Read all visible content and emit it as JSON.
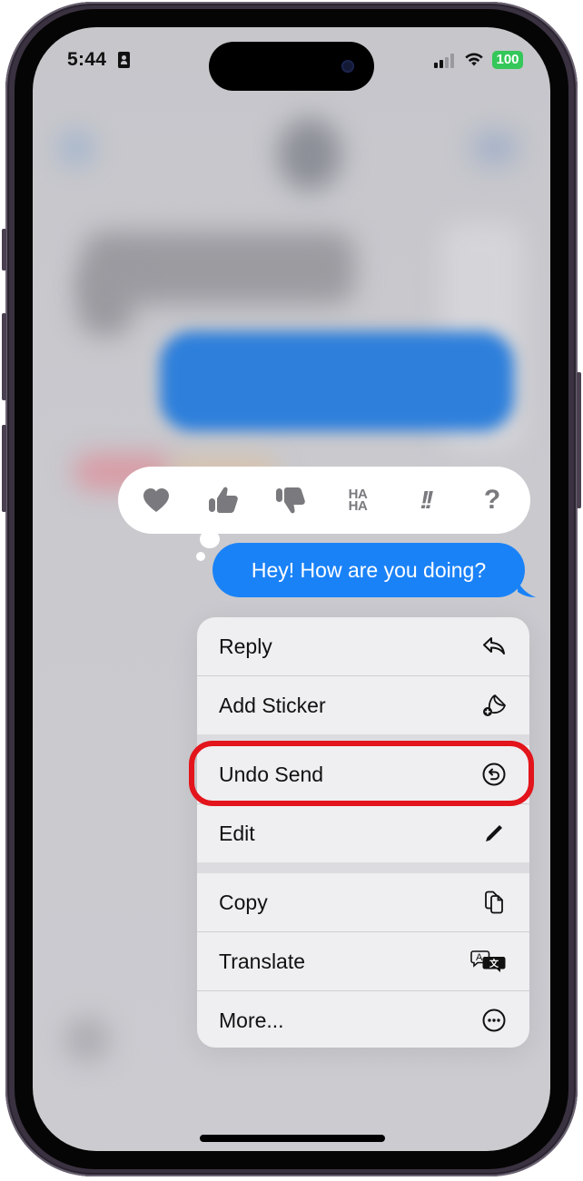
{
  "status_bar": {
    "time": "5:44",
    "battery": "100",
    "icons": [
      "contact-card-icon",
      "cellular-signal-icon",
      "wifi-icon",
      "battery-icon"
    ]
  },
  "reactions": [
    {
      "name": "heart",
      "icon": "heart-icon"
    },
    {
      "name": "thumbs-up",
      "icon": "thumbs-up-icon"
    },
    {
      "name": "thumbs-down",
      "icon": "thumbs-down-icon"
    },
    {
      "name": "haha",
      "label_top": "HA",
      "label_bottom": "HA",
      "icon": "haha-icon"
    },
    {
      "name": "emphasize",
      "label": "!!",
      "icon": "double-exclamation-icon"
    },
    {
      "name": "question",
      "label": "?",
      "icon": "question-mark-icon"
    }
  ],
  "message": {
    "text": "Hey! How are you doing?",
    "bubble_color": "#1a82f7"
  },
  "menu": {
    "items": [
      {
        "label": "Reply",
        "icon": "reply-arrow-icon"
      },
      {
        "label": "Add Sticker",
        "icon": "add-sticker-icon"
      },
      {
        "label": "Undo Send",
        "icon": "undo-send-icon",
        "highlighted": true
      },
      {
        "label": "Edit",
        "icon": "pencil-icon"
      },
      {
        "label": "Copy",
        "icon": "copy-documents-icon"
      },
      {
        "label": "Translate",
        "icon": "translate-icon"
      },
      {
        "label": "More...",
        "icon": "more-ellipsis-icon"
      }
    ]
  },
  "colors": {
    "highlight": "#e3141b",
    "battery": "#34c759",
    "imessage_blue": "#1a82f7",
    "reaction_gray": "#7a7a7e"
  }
}
